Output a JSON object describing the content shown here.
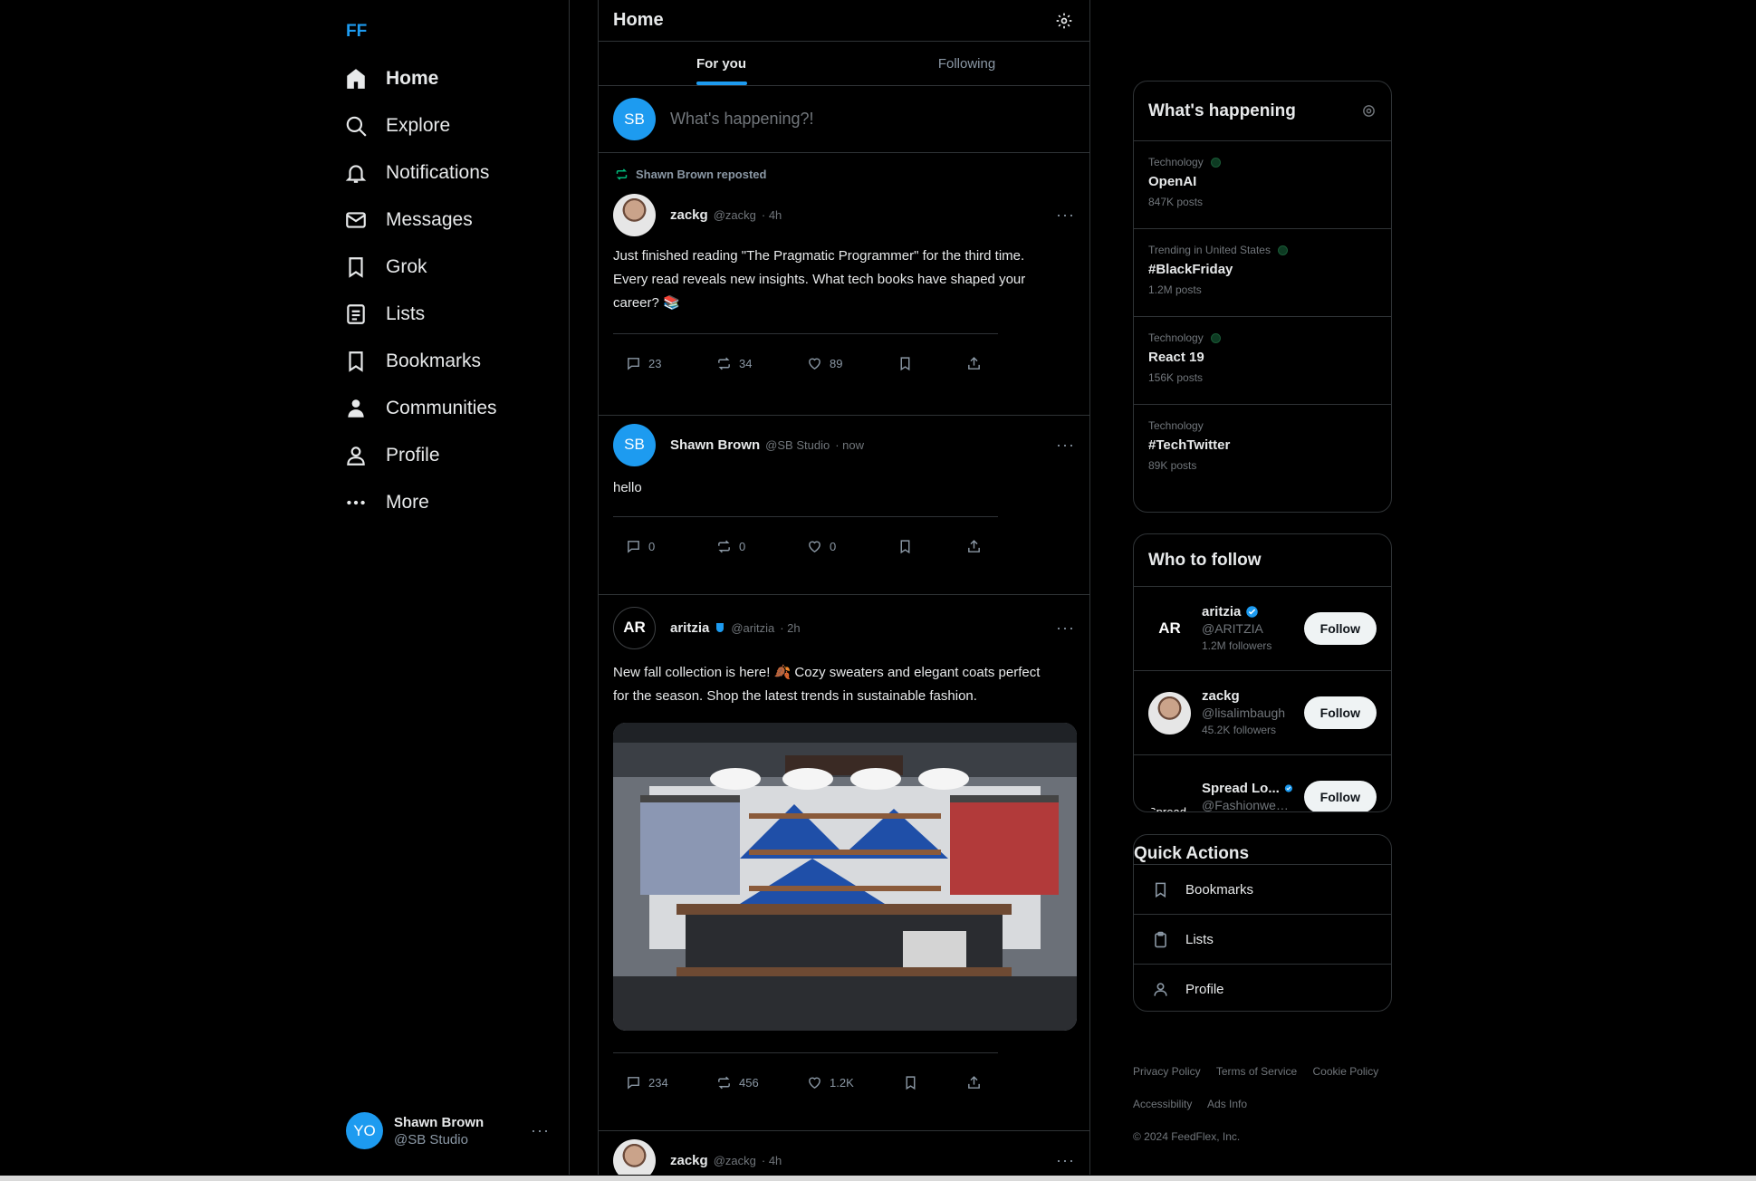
{
  "nav": {
    "logo": "FF",
    "items": [
      {
        "label": "Home",
        "icon": "home-icon",
        "active": true
      },
      {
        "label": "Explore",
        "icon": "search-icon"
      },
      {
        "label": "Notifications",
        "icon": "bell-icon"
      },
      {
        "label": "Messages",
        "icon": "mail-icon"
      },
      {
        "label": "Grok",
        "icon": "bookmark-icon"
      },
      {
        "label": "Lists",
        "icon": "list-icon"
      },
      {
        "label": "Bookmarks",
        "icon": "bookmark-icon"
      },
      {
        "label": "Communities",
        "icon": "people-icon"
      },
      {
        "label": "Profile",
        "icon": "person-icon"
      },
      {
        "label": "More",
        "icon": "more-icon"
      }
    ],
    "account": {
      "initials": "YO",
      "name": "Shawn Brown",
      "handle": "@SB Studio",
      "more": "···"
    }
  },
  "feed": {
    "title": "Home",
    "tabs": [
      {
        "label": "For you",
        "active": true
      },
      {
        "label": "Following"
      }
    ],
    "compose": {
      "initials": "SB",
      "placeholder": "What's happening?!"
    },
    "posts": [
      {
        "repost_label": "Shawn Brown reposted",
        "name": "zackg",
        "handle": "@zackg",
        "time": "· 4h",
        "text": "Just finished reading \"The Pragmatic Programmer\" for the third time.\nEvery read reveals new insights. What tech books have shaped your\ncareer? 📚",
        "replies": "23",
        "reposts": "34",
        "likes": "89"
      },
      {
        "name": "Shawn Brown",
        "initials": "SB",
        "handle": "@SB Studio",
        "time": "· now",
        "text": "hello",
        "replies": "0",
        "reposts": "0",
        "likes": "0"
      },
      {
        "name": "aritzia",
        "initials": "AR",
        "handle": "@aritzia",
        "time": "· 2h",
        "text": "New fall collection is here! 🍂 Cozy sweaters and elegant coats perfect\nfor the season. Shop the latest trends in sustainable fashion.",
        "replies": "234",
        "reposts": "456",
        "likes": "1.2K"
      },
      {
        "name": "zackg",
        "handle": "@zackg",
        "time": "· 4h"
      }
    ]
  },
  "trends": {
    "title": "What's happening",
    "items": [
      {
        "category": "Technology",
        "topic": "OpenAI",
        "count": "847K posts"
      },
      {
        "category": "Trending in United States",
        "topic": "#BlackFriday",
        "count": "1.2M posts"
      },
      {
        "category": "Technology",
        "topic": "React 19",
        "count": "156K posts"
      },
      {
        "category": "Technology",
        "topic": "#TechTwitter",
        "count": "89K posts"
      }
    ]
  },
  "who_to_follow": {
    "title": "Who to follow",
    "button_label": "Follow",
    "items": [
      {
        "initials": "AR",
        "name": "aritzia",
        "handle": "@ARITZIA",
        "followers": "1.2M followers"
      },
      {
        "name": "zackg",
        "handle": "@lisalimbaugh",
        "followers": "45.2K followers"
      },
      {
        "initials": "Spread",
        "name": "Spread Lo...",
        "handle": "@Fashionweek..."
      }
    ]
  },
  "quick_actions": {
    "title": "Quick Actions",
    "items": [
      {
        "label": "Bookmarks",
        "icon": "bookmark-icon"
      },
      {
        "label": "Lists",
        "icon": "clipboard-icon"
      },
      {
        "label": "Profile",
        "icon": "person-icon"
      }
    ]
  },
  "footer": {
    "links": [
      "Privacy Policy",
      "Terms of Service",
      "Cookie Policy",
      "Accessibility",
      "Ads Info"
    ],
    "copyright": "© 2024 FeedFlex, Inc."
  },
  "colors": {
    "accent": "#1d9bf0",
    "background": "#000000",
    "border": "#2f3336",
    "muted": "#71767b"
  }
}
